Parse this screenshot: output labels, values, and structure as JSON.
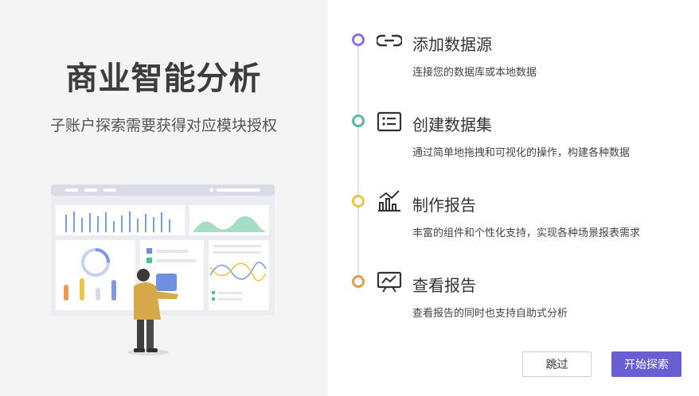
{
  "left": {
    "title": "商业智能分析",
    "subtitle": "子账户探索需要获得对应模块授权"
  },
  "steps": [
    {
      "title": "添加数据源",
      "desc": "连接您的数据库或本地数据",
      "dot_color": "#8a72e0",
      "icon": "link-icon"
    },
    {
      "title": "创建数据集",
      "desc": "通过简单地拖拽和可视化的操作，构建各种数据",
      "dot_color": "#5bb8a0",
      "icon": "list-card-icon"
    },
    {
      "title": "制作报告",
      "desc": "丰富的组件和个性化支持，实现各种场景报表需求",
      "dot_color": "#e8c64a",
      "icon": "bar-chart-trend-icon"
    },
    {
      "title": "查看报告",
      "desc": "查看报告的同时也支持自助式分析",
      "dot_color": "#d9a050",
      "icon": "presentation-chart-icon"
    }
  ],
  "buttons": {
    "skip": "跳过",
    "start": "开始探索"
  },
  "colors": {
    "accent": "#6a5fd0",
    "left_bg": "#f4f4f4"
  }
}
